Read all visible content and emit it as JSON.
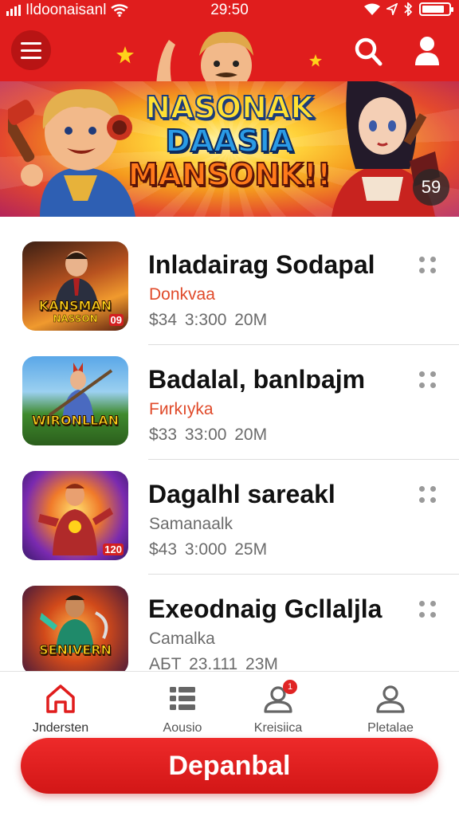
{
  "status_bar": {
    "carrier": "Ildoonaisanl",
    "time": "29:50",
    "battery_level": 0.75
  },
  "header": {
    "menu_icon": "hamburger-menu-icon",
    "search_icon": "search-icon",
    "profile_icon": "user-icon",
    "accent_color": "#e01d1d"
  },
  "banner": {
    "title_lines": [
      "NASONAK",
      "DAASIA",
      "MANSONK!!"
    ],
    "badge": "59"
  },
  "games": [
    {
      "title": "Inladairag Sodapal",
      "subtitle": "Donkvaa",
      "subtitle_color": "#e04a2a",
      "meta": "$34  3:300  20M",
      "thumb_caption": "KANSMAN",
      "thumb_caption2": "NASSON",
      "thumb_tag": "09"
    },
    {
      "title": "Badalal, banlɒajm",
      "subtitle": "Fиrkıyka",
      "subtitle_color": "#e04a2a",
      "meta": "$33  33:00  20M",
      "thumb_caption": "WIRONLLAN",
      "thumb_caption2": "",
      "thumb_tag": ""
    },
    {
      "title": "Dagalhl sareakl",
      "subtitle": "Samanaalk",
      "subtitle_color": "#6b6b6b",
      "meta": "$43  3:000  25M",
      "thumb_caption": "",
      "thumb_caption2": "",
      "thumb_tag": "120"
    },
    {
      "title": "Exeodnaig Gcllaljla",
      "subtitle": "Camalka",
      "subtitle_color": "#6b6b6b",
      "meta": "AБT  23.111  23M",
      "thumb_caption": "SENIVERN",
      "thumb_caption2": "",
      "thumb_tag": ""
    }
  ],
  "bottom_nav": [
    {
      "label": "Jndersten",
      "icon": "home-icon",
      "active": true
    },
    {
      "label": "Aousio",
      "icon": "grid-list-icon",
      "active": false
    },
    {
      "label": "Kreisiica",
      "icon": "user-notification-icon",
      "badge": "1",
      "active": false
    },
    {
      "label": "Pletalae",
      "icon": "user-icon",
      "active": false
    }
  ],
  "cta": {
    "label": "Depanbal"
  }
}
